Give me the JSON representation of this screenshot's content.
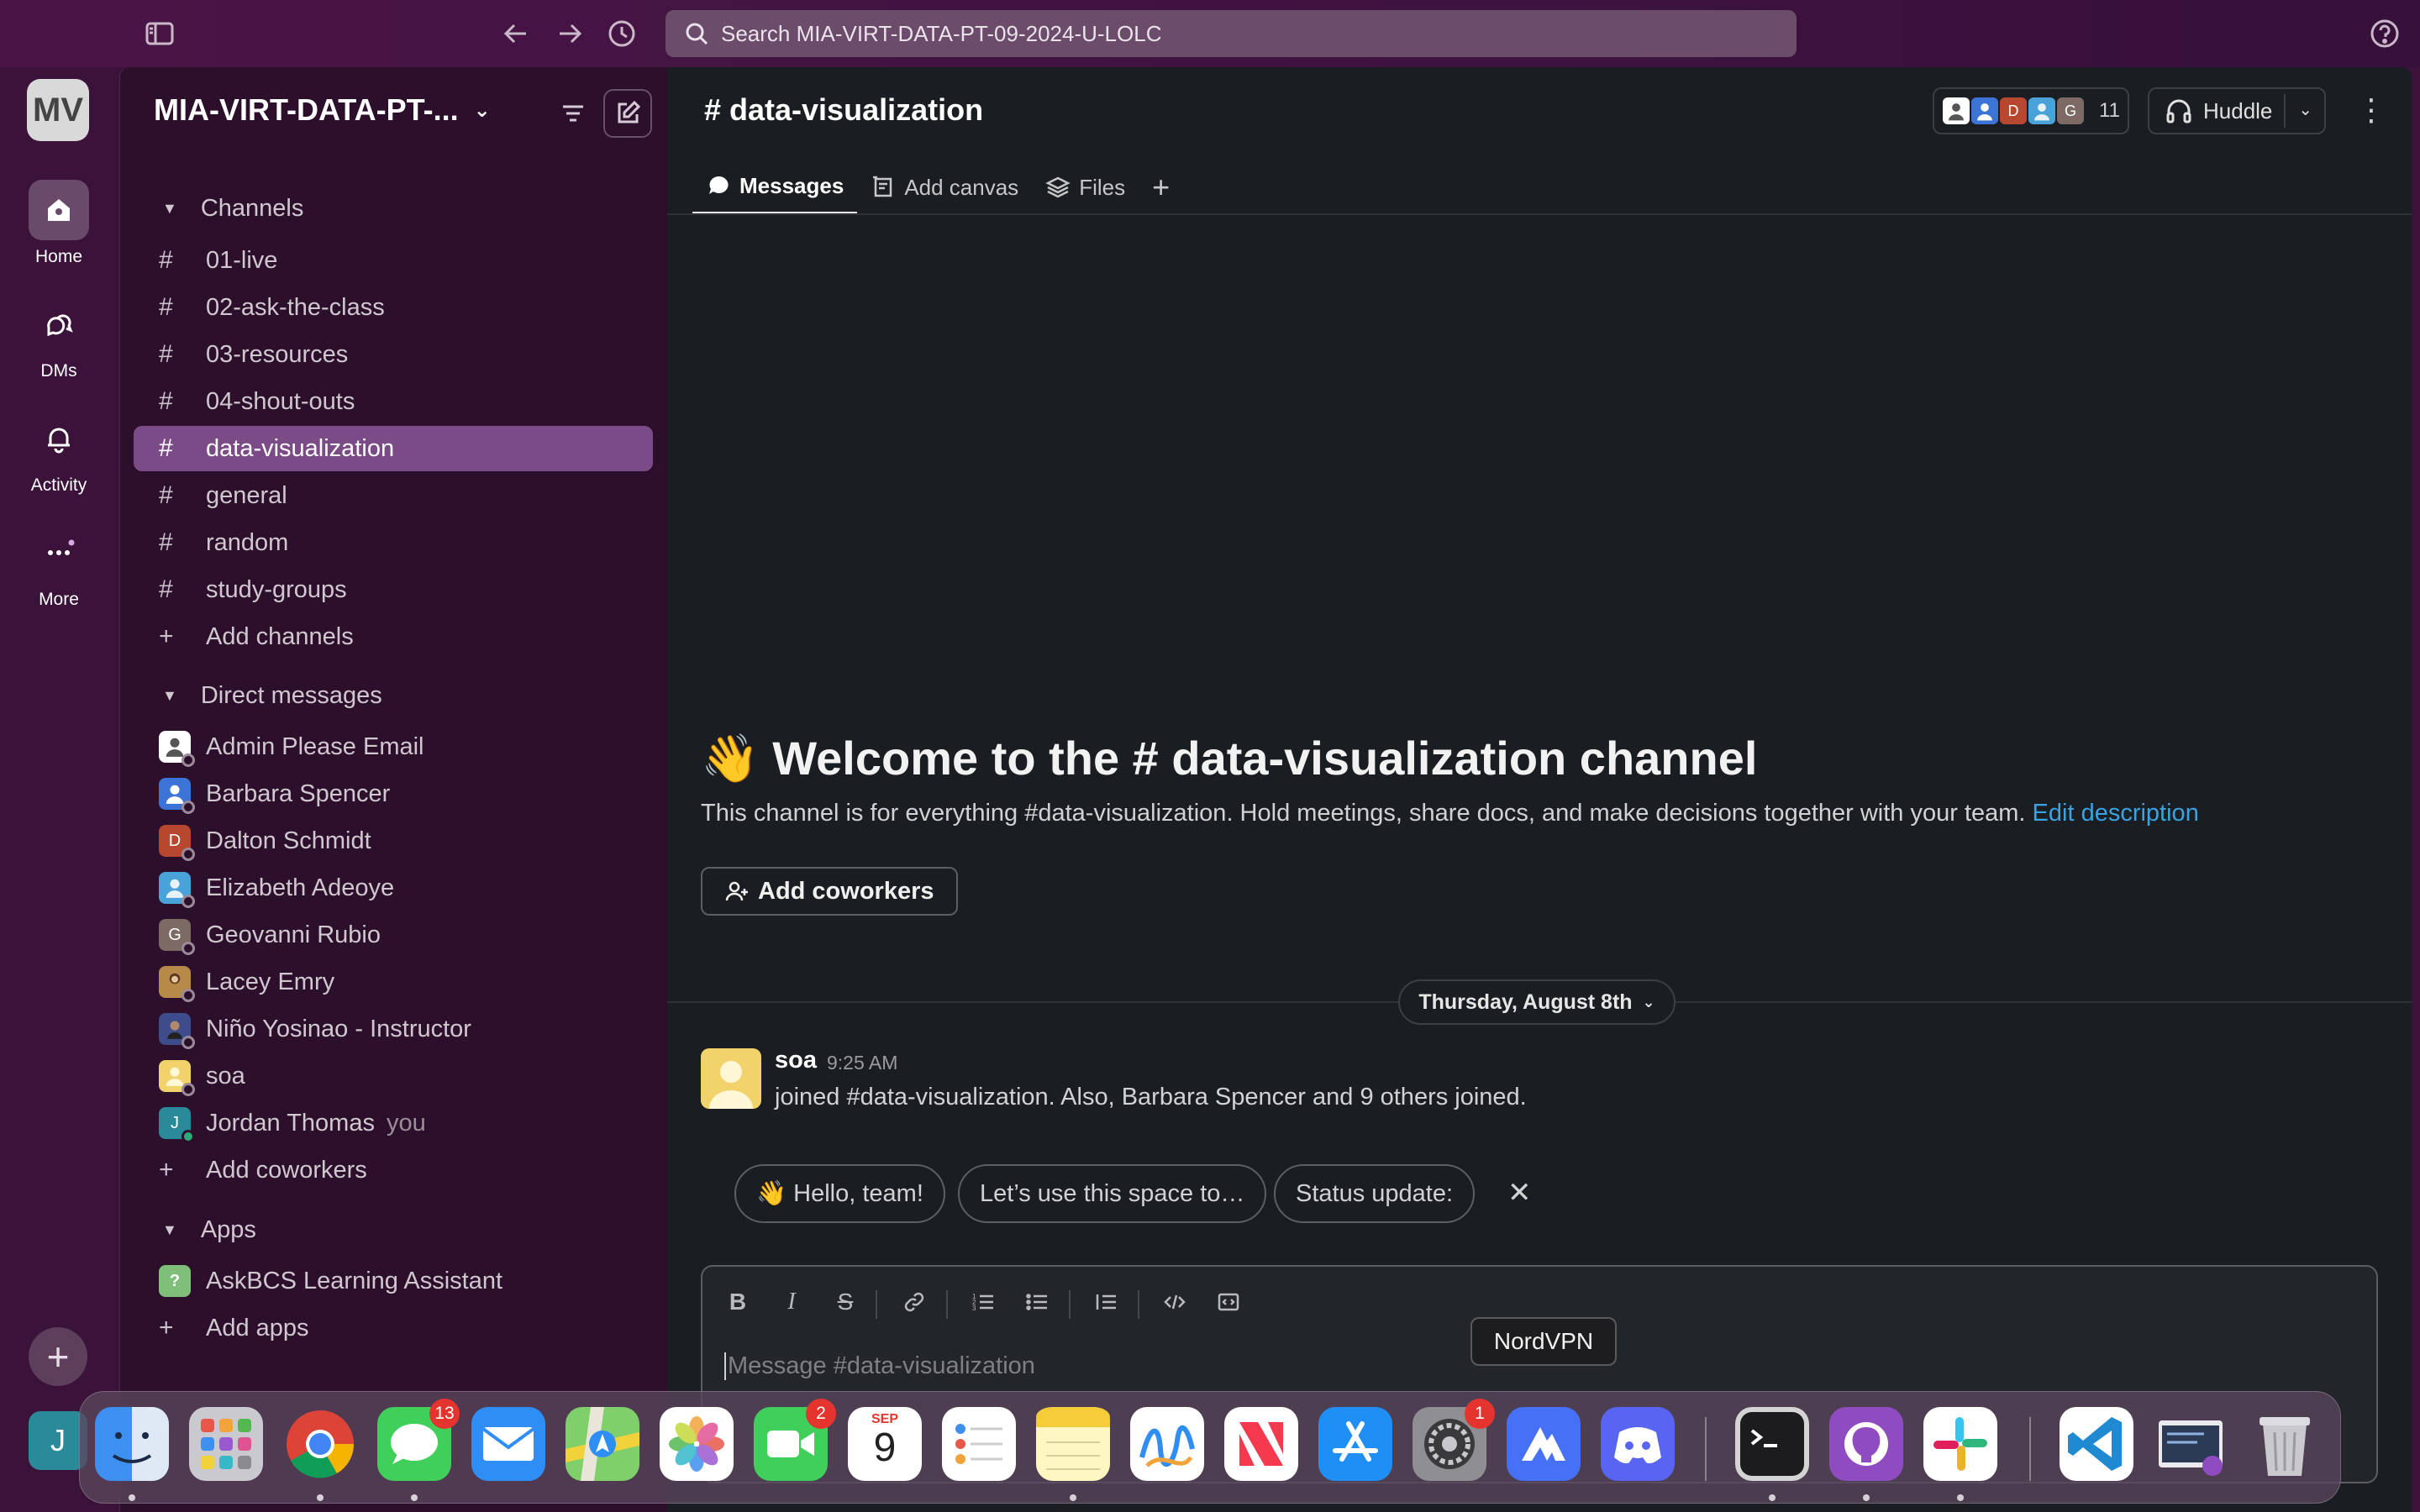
{
  "topbar": {
    "search_text": "Search MIA-VIRT-DATA-PT-09-2024-U-LOLC",
    "icons": [
      "sidebar-toggle-icon",
      "back-arrow-icon",
      "forward-arrow-icon",
      "history-icon",
      "help-icon"
    ]
  },
  "rail": {
    "workspace_initials": "MV",
    "items": [
      {
        "label": "Home",
        "icon": "home-icon"
      },
      {
        "label": "DMs",
        "icon": "dms-icon"
      },
      {
        "label": "Activity",
        "icon": "bell-icon"
      },
      {
        "label": "More",
        "icon": "more-icon"
      }
    ],
    "user_initial": "J"
  },
  "sidebar": {
    "workspace_name": "MIA-VIRT-DATA-PT-...",
    "channels_title": "Channels",
    "channels": [
      "01-live",
      "02-ask-the-class",
      "03-resources",
      "04-shout-outs",
      "data-visualization",
      "general",
      "random",
      "study-groups"
    ],
    "selected_channel": "data-visualization",
    "add_channels": "Add channels",
    "dm_title": "Direct messages",
    "dms": [
      {
        "name": "Admin Please Email",
        "initial": "",
        "color": "#ffffff"
      },
      {
        "name": "Barbara Spencer",
        "initial": "",
        "color": "#3b74d6"
      },
      {
        "name": "Dalton Schmidt",
        "initial": "D",
        "color": "#b8472f"
      },
      {
        "name": "Elizabeth Adeoye",
        "initial": "",
        "color": "#4aa3d8"
      },
      {
        "name": "Geovanni Rubio",
        "initial": "G",
        "color": "#7d6a64"
      },
      {
        "name": "Lacey Emry",
        "initial": "",
        "color": "#b88a4a"
      },
      {
        "name": "Niño Yosinao - Instructor",
        "initial": "",
        "color": "#3d4c8a"
      },
      {
        "name": "soa",
        "initial": "",
        "color": "#f2d36b"
      },
      {
        "name": "Jordan Thomas",
        "initial": "J",
        "color": "#2a8a9a",
        "suffix": "you"
      }
    ],
    "add_coworkers": "Add coworkers",
    "apps_title": "Apps",
    "apps": [
      "AskBCS Learning Assistant"
    ],
    "add_apps": "Add apps"
  },
  "channel": {
    "title": "# data-visualization",
    "member_count": "11",
    "huddle_label": "Huddle",
    "tabs": [
      {
        "label": "Messages",
        "icon": "message-icon"
      },
      {
        "label": "Add canvas",
        "icon": "canvas-icon"
      },
      {
        "label": "Files",
        "icon": "files-icon"
      }
    ],
    "welcome_emoji": "👋",
    "welcome_title": "Welcome to the # data-visualization channel",
    "welcome_desc": "This channel is for everything #data-visualization. Hold meetings, share docs, and make decisions together with your team.",
    "edit_description": "Edit description",
    "add_coworkers_button": "Add coworkers",
    "date_divider": "Thursday, August 8th",
    "message": {
      "author": "soa",
      "time": "9:25 AM",
      "text": "joined #data-visualization. Also, Barbara Spencer and 9 others joined."
    },
    "suggestions": [
      "👋 Hello, team!",
      "Let’s use this space to…",
      "Status update:"
    ],
    "composer_placeholder": "Message #data-visualization"
  },
  "dock": {
    "tooltip": "NordVPN",
    "apps": [
      {
        "name": "Finder"
      },
      {
        "name": "Launchpad"
      },
      {
        "name": "Chrome"
      },
      {
        "name": "Messages",
        "badge": "13"
      },
      {
        "name": "Mail"
      },
      {
        "name": "Maps"
      },
      {
        "name": "Photos"
      },
      {
        "name": "FaceTime",
        "badge": "2"
      },
      {
        "name": "Calendar",
        "month": "SEP",
        "day": "9"
      },
      {
        "name": "Reminders"
      },
      {
        "name": "Notes"
      },
      {
        "name": "Freeform"
      },
      {
        "name": "News"
      },
      {
        "name": "App Store"
      },
      {
        "name": "System Settings",
        "badge": "1"
      },
      {
        "name": "NordVPN"
      },
      {
        "name": "Discord"
      },
      {
        "name": "Terminal"
      },
      {
        "name": "GitHub Desktop"
      },
      {
        "name": "Slack"
      },
      {
        "name": "VS Code"
      },
      {
        "name": "Downloads"
      },
      {
        "name": "Trash"
      }
    ]
  }
}
